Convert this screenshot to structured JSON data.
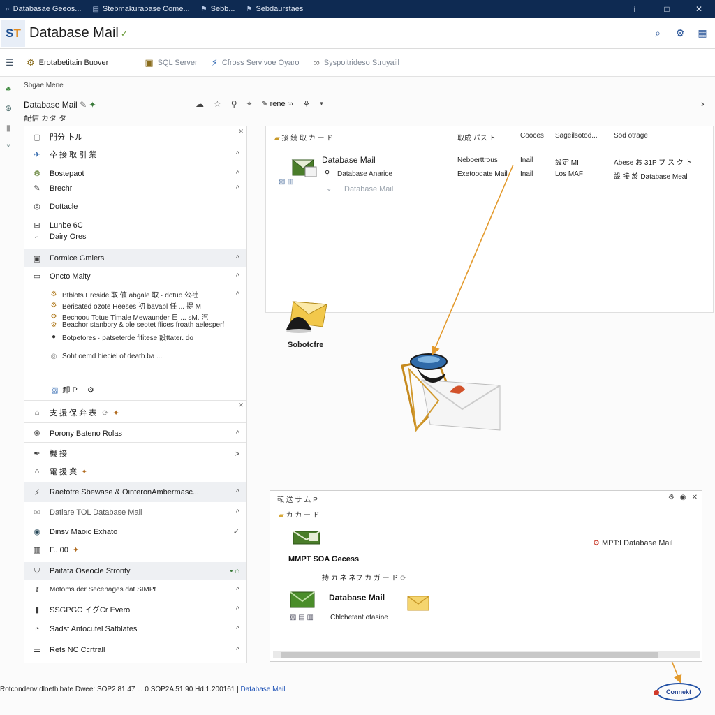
{
  "titlebar": {
    "tabs": [
      {
        "label": "Databasae Geeos...",
        "icon": "search-icon"
      },
      {
        "label": "Stebmakurabase Come...",
        "icon": "document-icon"
      },
      {
        "label": "Sebb...",
        "icon": "pin-icon"
      },
      {
        "label": "Sebdaurstaes",
        "icon": "pin-icon"
      }
    ],
    "buttons": [
      "i",
      "□",
      "✕"
    ]
  },
  "app": {
    "logo": "S",
    "logo_accent": "T",
    "title": "Database Mail",
    "title_caret": "✓"
  },
  "toolbar": {
    "items": [
      {
        "label": "Erotabetitain Buover",
        "icon": "tree-icon"
      },
      {
        "label": "SQL Server",
        "icon": "server-icon"
      },
      {
        "label": "Cfross Servivoe Oyaro",
        "icon": "plug-icon"
      },
      {
        "label": "Syspoitrideso Struyaiil",
        "icon": "link-icon"
      }
    ]
  },
  "breadcrumb": "Sbgae Mene",
  "object": {
    "title": "Database Mail",
    "subtitle": "配信 カタ タ",
    "tool_chip": "✎ rene ∞"
  },
  "tree": {
    "top": [
      {
        "label": "門分 卜ル",
        "icon": "box-icon"
      },
      {
        "label": "卒 接 取 引 業",
        "icon": "pin-icon",
        "chev": "^"
      },
      {
        "label": "Bostepaot",
        "icon": "gear-icon",
        "chev": "^"
      },
      {
        "label": "Brechr",
        "icon": "pencil-icon",
        "chev": "^"
      },
      {
        "label": "Dottacle",
        "icon": "target-icon"
      },
      {
        "label": "Lunbe 6C",
        "icon": "car-icon"
      },
      {
        "label": "Dairy Ores",
        "icon": "search-icon"
      }
    ],
    "section1": {
      "label": "Formice Gmiers",
      "chev": "^"
    },
    "section2": {
      "label": "Oncto Maity",
      "chev": "^"
    },
    "subitems": [
      "Btblots Ereside 取 値 abgale 取 · dotuo 公社",
      "Berisated ozote Heeses 初 bavabl 任 ... 提 M",
      "Bechoou Totue Timale Mewaunder 日 ... sM. 汽",
      "Beachor stanbory & ole seotet ffices froath aelesperf",
      "Botpetores · patseterde fifitese 設ttater. do",
      "Soht oemd hieciel of deatb.ba ..."
    ],
    "footer_item": "卸 P",
    "groups": [
      {
        "label": "支 援 保 弁 表",
        "icon": "lock-icon"
      },
      {
        "label": "Porony Bateno Rolas",
        "icon": "fingerprint-icon",
        "chev": "^"
      },
      {
        "label": "機 接",
        "icon": "pen-icon",
        "chev": ">"
      },
      {
        "label": "電 援 業",
        "icon": "lock-icon"
      },
      {
        "label": "Raetotre Sbewase & OinteronAmbermasc...",
        "icon": "plug-icon",
        "chev": "^"
      },
      {
        "label": "Datiare TOL Database Mail",
        "icon": "mail-icon",
        "chev": "^"
      },
      {
        "label": "Dinsv Maoic Exhato",
        "icon": "globe-icon",
        "chev": "✓"
      },
      {
        "label": "F.. 00",
        "icon": "chart-icon"
      },
      {
        "label": "Paitata Oseocle Stronty",
        "icon": "shield-icon"
      },
      {
        "label": "Motoms der Secenages dat SIMPt",
        "icon": "key-icon",
        "chev": "^"
      },
      {
        "label": "SSGPGC イグCr Evero",
        "icon": "phone-icon",
        "chev": "^"
      },
      {
        "label": "Sadst Antocutel Satblates",
        "icon": "clock-icon",
        "chev": "^"
      },
      {
        "label": "Rets NC Ccrtrall",
        "icon": "list-icon",
        "chev": "^"
      }
    ]
  },
  "grid": {
    "headers": [
      "接 続 取 カ ー ド",
      "取成 パス ト",
      "Cooces",
      "Sageilsotod...",
      "Sod otrage"
    ],
    "node_title": "Database Mail",
    "node_sub": "Database Anarice",
    "node_faded": "Database Mail",
    "rows": [
      [
        "Neboerttrous",
        "Inail",
        "設定 MI",
        "Abese お 31P ブ ス ク ト"
      ],
      [
        "Exetoodate Mail",
        "Inail",
        "Los MAF",
        "設 接 於 Database Meal"
      ]
    ]
  },
  "float": {
    "label": "Sobotcfre"
  },
  "props": {
    "title": "転 送 サ ム P",
    "folder": "カ カ ー ド",
    "mtp_label": "MMPT SOA Gecess",
    "network_label": "持 カ ネ ネフ カ ガ ー ド",
    "dbmail_label": "Database Mail",
    "status": "Chlchetant otasine",
    "right_label": "MPT:I Database Mail"
  },
  "statusbar": {
    "text": "Rotcondenv dloethibate Dwee: SOP2 81 47 ... 0 SOP2A 51 90 Hd.1.200161",
    "link": "Database Mail"
  },
  "brand": "Connekt",
  "colors": {
    "titlebar": "#0e2a52",
    "accent": "#1d4f91",
    "arrow": "#e39a2d"
  }
}
